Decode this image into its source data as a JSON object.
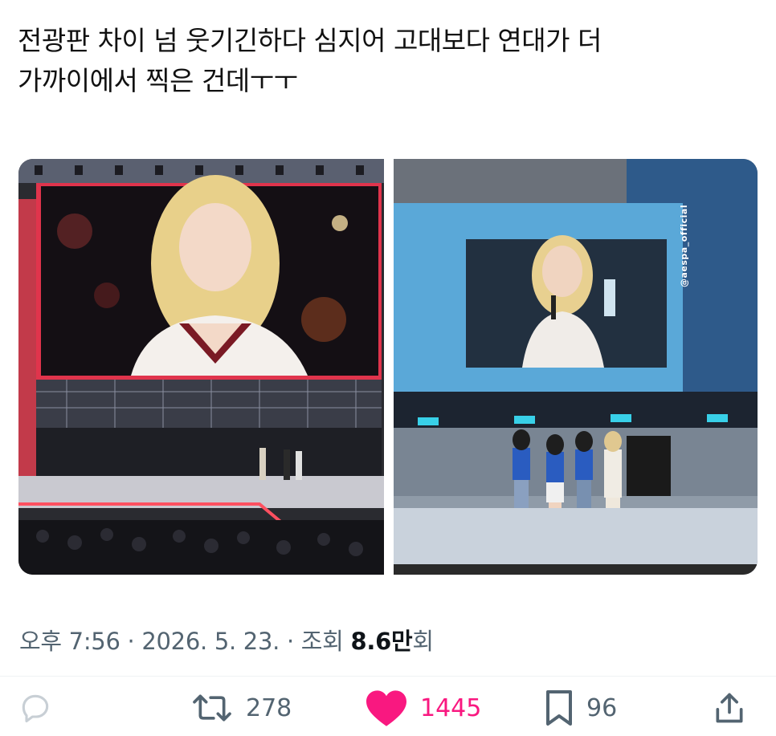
{
  "tweet": {
    "text_line1": "전광판 차이 넘 웃기긴하다 심지어 고대보다 연대가 더",
    "text_line2": "가까이에서 찍은 건데ㅜㅜ"
  },
  "media": {
    "left_photo_icon": "concert-stage-photo",
    "right_photo_icon": "concert-stage-photo",
    "right_watermark": "@aespa_official"
  },
  "meta": {
    "time": "오후 7:56",
    "separator": " · ",
    "date": "2026. 5. 23.",
    "views_label": "조회",
    "views_number": "8.6만",
    "views_suffix": "회"
  },
  "actions": {
    "reply_icon": "reply-icon",
    "retweet_icon": "retweet-icon",
    "retweet_count": "278",
    "like_icon": "heart-icon",
    "like_count": "1445",
    "bookmark_icon": "bookmark-icon",
    "bookmark_count": "96",
    "share_icon": "share-icon"
  },
  "colors": {
    "like": "#f91880",
    "muted": "#536471",
    "text": "#0f1419"
  }
}
